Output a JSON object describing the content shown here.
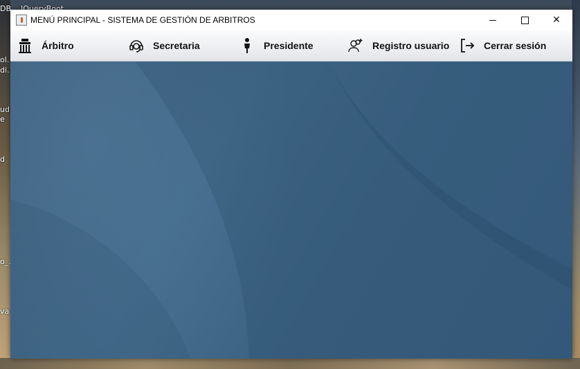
{
  "window": {
    "title": "MENÚ PRINCIPAL - SISTEMA DE GESTIÓN DE ARBITROS",
    "close_glyph": "✕"
  },
  "menu": {
    "items": [
      {
        "label": "Árbitro",
        "icon": "referee-icon"
      },
      {
        "label": "Secretaria",
        "icon": "headset-icon"
      },
      {
        "label": "Presidente",
        "icon": "person-icon"
      },
      {
        "label": "Registro usuario",
        "icon": "add-user-icon"
      },
      {
        "label": "Cerrar sesión",
        "icon": "logout-icon"
      }
    ]
  },
  "desktop": {
    "labels": [
      "DB...",
      "JQueryBoot",
      "ol.",
      "di.",
      "udi",
      "e",
      "d",
      "o_...",
      "va..."
    ]
  }
}
